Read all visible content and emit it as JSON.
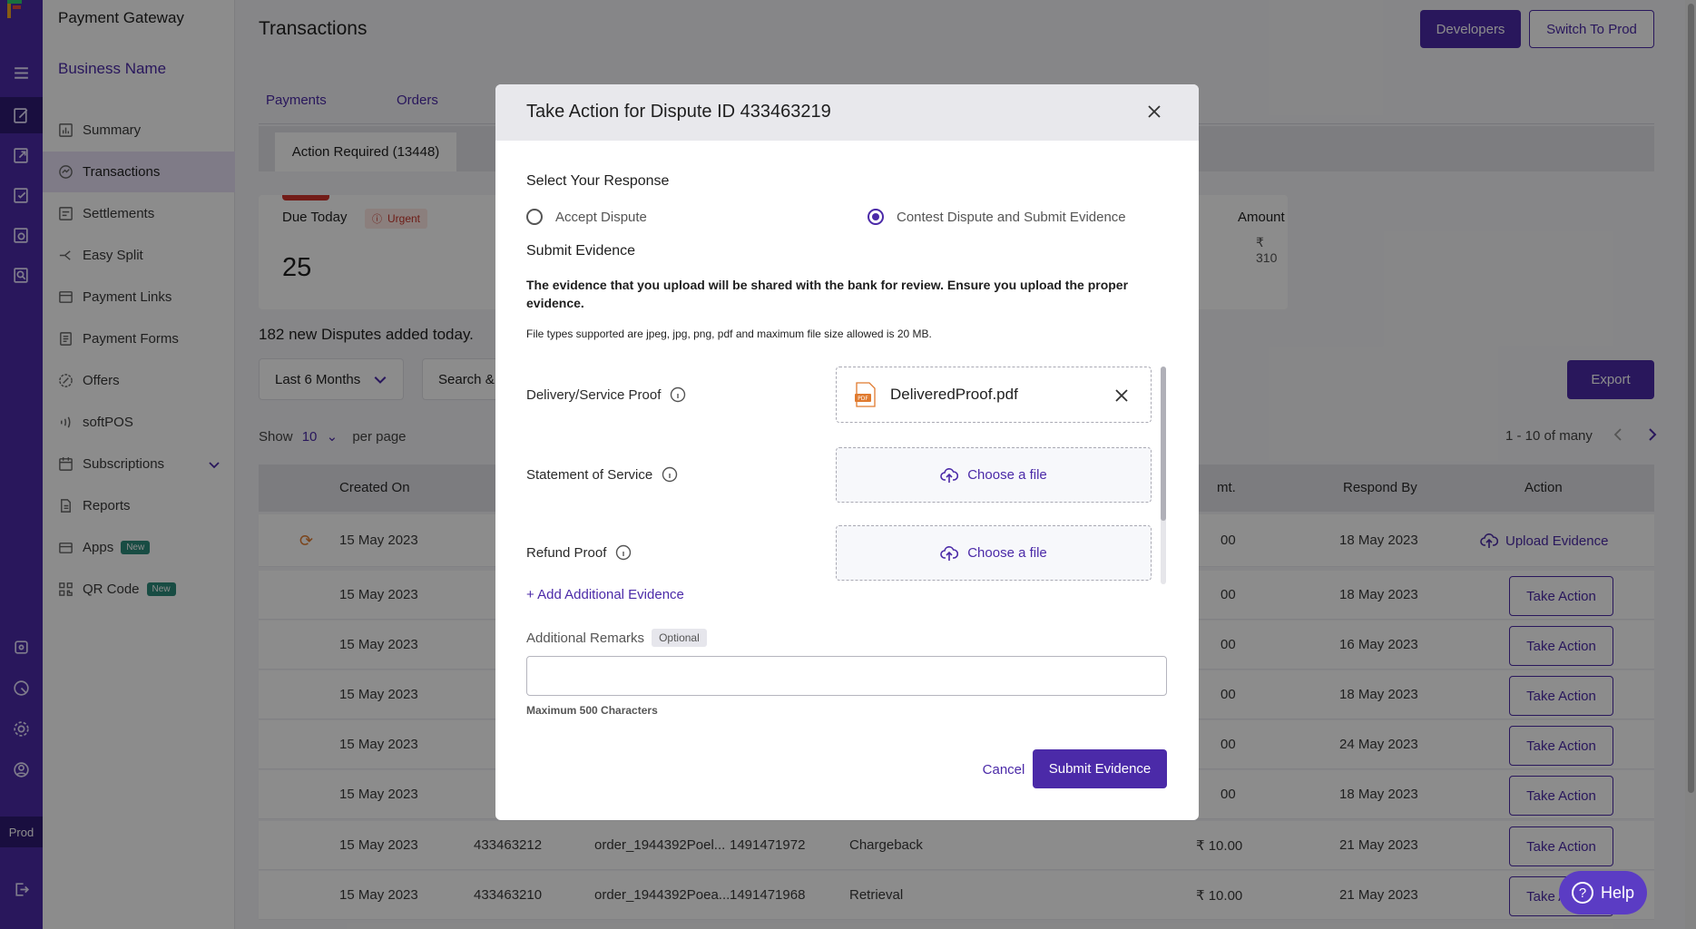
{
  "sidebar": {
    "app_title": "Payment Gateway",
    "business_name": "Business Name",
    "items": [
      {
        "label": "Summary"
      },
      {
        "label": "Transactions"
      },
      {
        "label": "Settlements"
      },
      {
        "label": "Easy Split"
      },
      {
        "label": "Payment Links"
      },
      {
        "label": "Payment Forms"
      },
      {
        "label": "Offers"
      },
      {
        "label": "softPOS"
      },
      {
        "label": "Subscriptions"
      },
      {
        "label": "Reports"
      },
      {
        "label": "Apps",
        "badge": "New"
      },
      {
        "label": "QR Code",
        "badge": "New"
      }
    ],
    "env_label": "Prod"
  },
  "header": {
    "title": "Transactions",
    "developers_label": "Developers",
    "switch_label": "Switch To Prod"
  },
  "tabs": [
    {
      "label": "Payments"
    },
    {
      "label": "Orders"
    }
  ],
  "subtab": {
    "label": "Action Required (13448)"
  },
  "summary_card": {
    "due_label": "Due Today",
    "urgent_label": "Urgent",
    "count": "25",
    "amount_label": "Amount",
    "amount_value": "₹ 310"
  },
  "disputes_note": "182 new Disputes added today.",
  "filters": {
    "range_label": "Last 6 Months",
    "search_label": "Search &",
    "export_label": "Export"
  },
  "pagination": {
    "show_label": "Show",
    "per_page_value": "10",
    "per_page_label": "per page",
    "range_text": "1 - 10 of many"
  },
  "table": {
    "headers": {
      "created_on": "Created On",
      "amt": "mt.",
      "respond_by": "Respond By",
      "action": "Action"
    },
    "rows": [
      {
        "created": "15 May 2023",
        "amt": "00",
        "respond": "18 May 2023",
        "action": "Upload Evidence"
      },
      {
        "created": "15 May 2023",
        "amt": "00",
        "respond": "18 May 2023",
        "action": "Take Action"
      },
      {
        "created": "15 May 2023",
        "amt": "00",
        "respond": "16 May 2023",
        "action": "Take Action"
      },
      {
        "created": "15 May 2023",
        "amt": "00",
        "respond": "18 May 2023",
        "action": "Take Action"
      },
      {
        "created": "15 May 2023",
        "amt": "00",
        "respond": "24 May 2023",
        "action": "Take Action"
      },
      {
        "created": "15 May 2023",
        "amt": "00",
        "respond": "18 May 2023",
        "action": "Take Action"
      },
      {
        "created": "15 May 2023",
        "id": "433463212",
        "order": "order_1944392Poel...",
        "ref": "1491471972",
        "type": "Chargeback",
        "amt": "₹ 10.00",
        "respond": "21 May 2023",
        "action": "Take Action"
      },
      {
        "created": "15 May 2023",
        "id": "433463210",
        "order": "order_1944392Poea...",
        "ref": "1491471968",
        "type": "Retrieval",
        "amt": "₹ 10.00",
        "respond": "21 May 2023",
        "action": "Take Action"
      }
    ]
  },
  "modal": {
    "title": "Take Action for Dispute ID 433463219",
    "select_response": "Select Your Response",
    "option_accept": "Accept Dispute",
    "option_contest": "Contest Dispute and Submit Evidence",
    "submit_evidence_heading": "Submit Evidence",
    "description": "The evidence that you upload will be shared with the bank for review. Ensure you upload the proper evidence.",
    "file_note": "File types supported are jpeg, jpg, png, pdf and maximum file size allowed is 20 MB.",
    "evidence": [
      {
        "label": "Delivery/Service Proof",
        "file": "DeliveredProof.pdf"
      },
      {
        "label": "Statement of Service",
        "button": "Choose a file"
      },
      {
        "label": "Refund Proof",
        "button": "Choose a file"
      }
    ],
    "add_evidence": "+ Add Additional Evidence",
    "remarks_label": "Additional Remarks",
    "optional_tag": "Optional",
    "remarks_value": "",
    "max_chars": "Maximum 500 Characters",
    "cancel_label": "Cancel",
    "submit_label": "Submit Evidence"
  },
  "help_label": "Help",
  "colors": {
    "brand": "#4b2aa8",
    "urgent": "#d0342c"
  }
}
